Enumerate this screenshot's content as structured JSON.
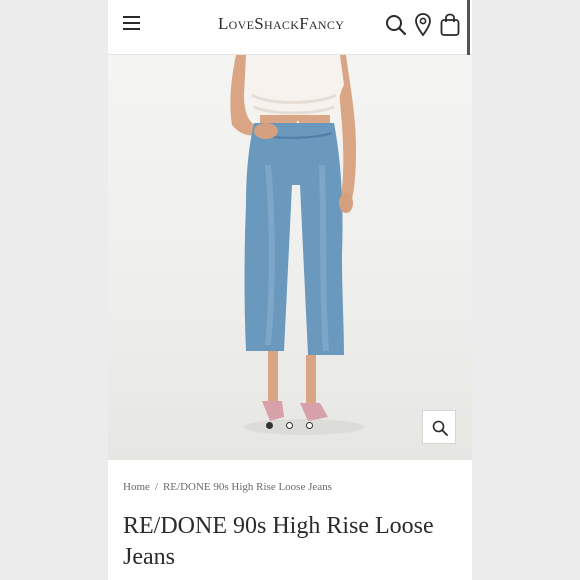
{
  "header": {
    "logo": "LoveShackFancy",
    "icons": [
      "hamburger-menu-icon",
      "search-icon",
      "location-pin-icon",
      "shopping-bag-icon"
    ]
  },
  "gallery": {
    "slide_count": 3,
    "active_slide": 1,
    "zoom_icon": "magnifier-icon"
  },
  "breadcrumb": {
    "home": "Home",
    "separator": "/",
    "current": "RE/DONE 90s High Rise Loose Jeans"
  },
  "product": {
    "title": "RE/DONE 90s High Rise Loose Jeans"
  },
  "colors": {
    "text": "#2b2b2b",
    "denim": "#5f8fb5",
    "background": "#ececec"
  }
}
